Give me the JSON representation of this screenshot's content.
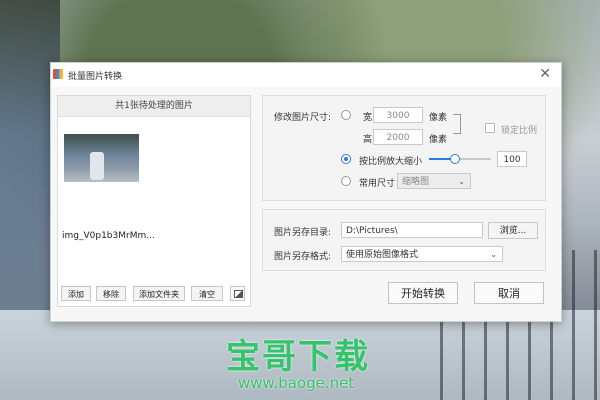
{
  "window": {
    "title": "批量图片转换",
    "close_icon": "close-icon"
  },
  "file_list": {
    "header": "共1张待处理的图片",
    "files": [
      {
        "name": "img_V0p1b3MrMm..."
      }
    ],
    "buttons": {
      "add": "添加",
      "remove": "移除",
      "add_folder": "添加文件夹",
      "clear": "清空"
    }
  },
  "resize": {
    "label": "修改图片尺寸:",
    "width_label": "宽",
    "width_value": "3000",
    "height_label": "高",
    "height_value": "2000",
    "unit": "像素",
    "lock_ratio_label": "锁定比例",
    "scale_label": "按比例放大缩小",
    "scale_value": "100",
    "slider_fraction": 0.45,
    "common_size_label": "常用尺寸",
    "common_size_value": "缩略图"
  },
  "output": {
    "dir_label": "图片另存目录:",
    "dir_value": "D:\\Pictures\\",
    "browse": "浏览...",
    "format_label": "图片另存格式:",
    "format_value": "使用原始图像格式"
  },
  "actions": {
    "start": "开始转换",
    "cancel": "取消"
  },
  "watermark": {
    "main": "宝哥下载",
    "sub": "www.baoge.net"
  },
  "colors": {
    "accent": "#2b78e4",
    "watermark": "#35c36b"
  }
}
